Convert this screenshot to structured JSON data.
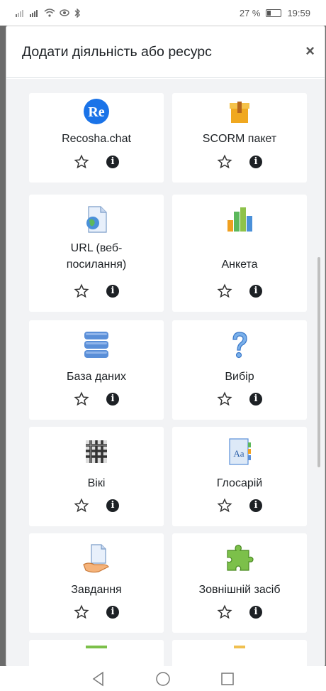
{
  "status_bar": {
    "left_icons": [
      "signal-weak-icon",
      "signal-icon",
      "wifi-icon",
      "eye-icon",
      "bluetooth-icon"
    ],
    "battery_text": "27 %",
    "battery_level": 0.27,
    "time": "19:59"
  },
  "modal": {
    "title": "Додати діяльність або ресурс",
    "close_label": "×"
  },
  "activities": [
    {
      "name": "Recosha.chat",
      "icon": "recosha-logo-icon"
    },
    {
      "name": "SCORM пакет",
      "icon": "scorm-package-icon"
    },
    {
      "name": "URL (веб-посилання)",
      "line1": "URL (веб-",
      "line2": "посилання)",
      "icon": "url-globe-icon"
    },
    {
      "name": "Анкета",
      "icon": "bar-chart-icon"
    },
    {
      "name": "База даних",
      "icon": "database-icon"
    },
    {
      "name": "Вибір",
      "icon": "question-mark-icon"
    },
    {
      "name": "Вікі",
      "icon": "wiki-icon"
    },
    {
      "name": "Глосарій",
      "icon": "glossary-book-icon"
    },
    {
      "name": "Завдання",
      "icon": "assignment-hand-icon"
    },
    {
      "name": "Зовнішній засіб",
      "icon": "puzzle-icon"
    }
  ],
  "card_actions": {
    "star": "star-outline-icon",
    "info": "info-icon",
    "info_glyph": "i"
  },
  "colors": {
    "accent_blue": "#1a73e8",
    "background": "#f2f3f5",
    "card": "#ffffff",
    "overlay": "#6b6b6b"
  }
}
